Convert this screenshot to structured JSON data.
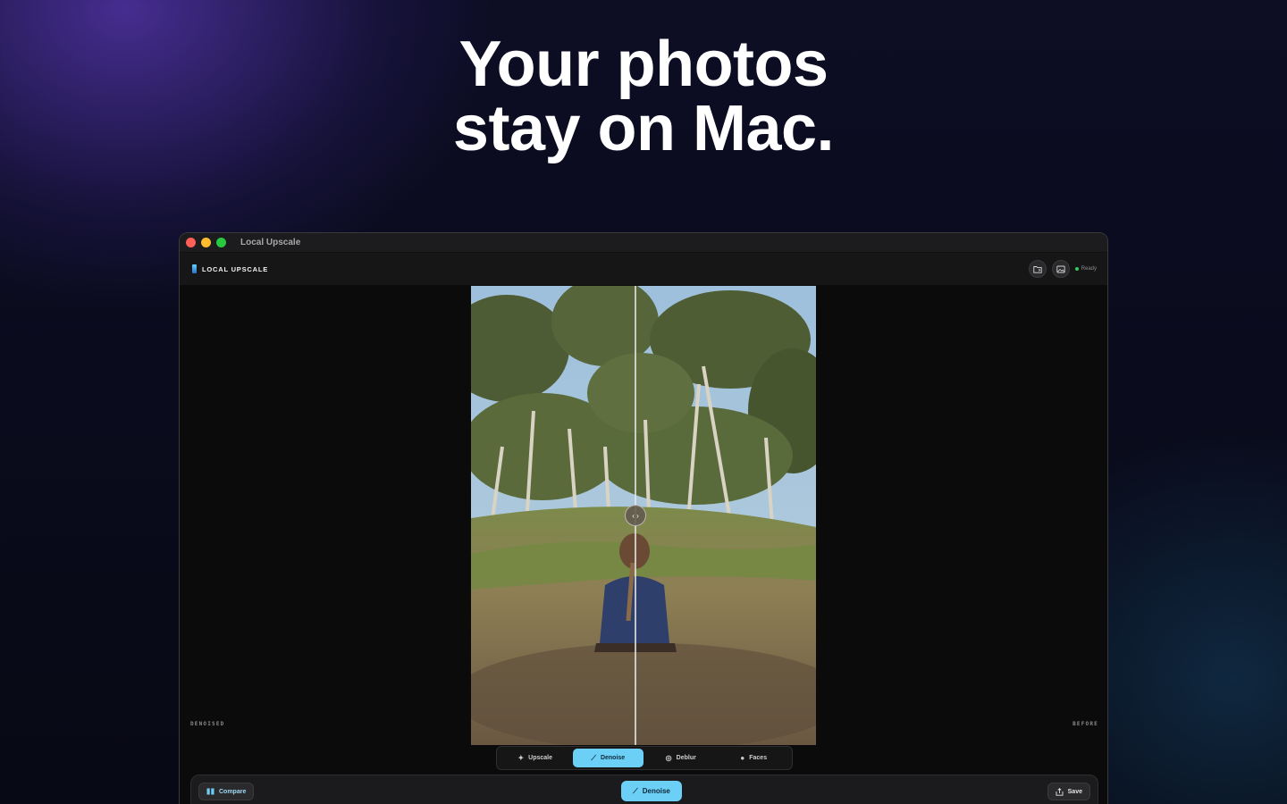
{
  "hero": {
    "line1": "Your photos",
    "line2": "stay on Mac."
  },
  "window": {
    "title": "Local Upscale",
    "brand": "LOCAL UPSCALE",
    "status": "Ready",
    "icons": [
      "folder-icon",
      "image-icon"
    ]
  },
  "viewer": {
    "left_label": "DENOISED",
    "right_label": "BEFORE",
    "handle_glyph": "‹ ›"
  },
  "modes": [
    {
      "label": "Upscale",
      "icon": "✦",
      "active": false
    },
    {
      "label": "Denoise",
      "icon": "⟋",
      "active": true
    },
    {
      "label": "Deblur",
      "icon": "◎",
      "active": false
    },
    {
      "label": "Faces",
      "icon": "●",
      "active": false
    }
  ],
  "bottombar": {
    "compare_label": "Compare",
    "primary_label": "Denoise",
    "save_label": "Save"
  },
  "colors": {
    "accent": "#6ccff6",
    "ready": "#34c759"
  }
}
